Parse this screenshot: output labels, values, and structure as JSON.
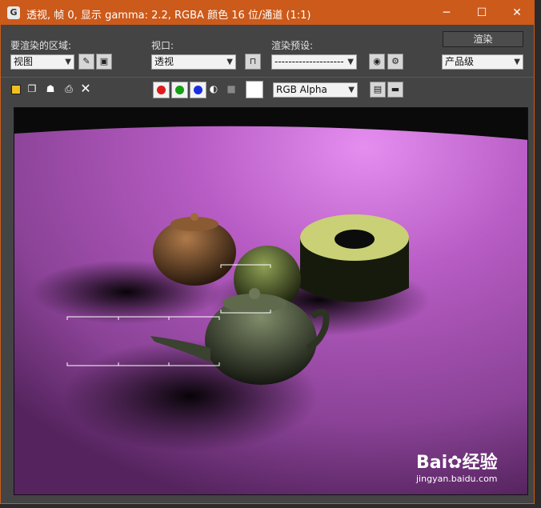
{
  "window": {
    "title": "透视, 帧 0, 显示 gamma: 2.2, RGBA 颜色 16 位/通道 (1:1)",
    "icon_glyph": "G",
    "min_glyph": "─",
    "max_glyph": "☐",
    "close_glyph": "✕"
  },
  "controls": {
    "area_label": "要渲染的区域:",
    "area_value": "视图",
    "viewport_label": "视口:",
    "viewport_value": "透视",
    "preset_label": "渲染预设:",
    "preset_value": "--------------------",
    "render_button": "渲染",
    "quality_value": "产品级"
  },
  "channel_dropdown": "RGB Alpha",
  "colors": {
    "titlebar": "#cc5a1a",
    "panel": "#444444",
    "red_channel": "#e01a1a",
    "green_channel": "#14a014",
    "blue_channel": "#1a2ee0"
  },
  "watermark": {
    "brand": "Bai",
    "brand_suffix": "经验",
    "url": "jingyan.baidu.com"
  },
  "icons": [
    "save-icon",
    "copy-icon",
    "clone-icon",
    "print-icon",
    "clear-icon",
    "lock-icon",
    "mono-icon",
    "swatch-icon"
  ]
}
